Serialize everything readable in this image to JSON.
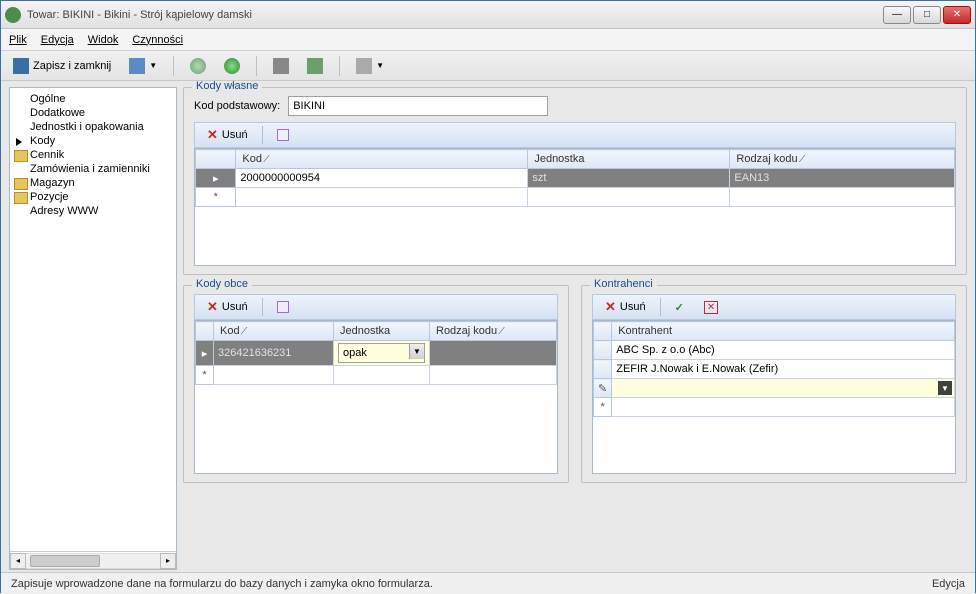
{
  "window": {
    "title": "Towar: BIKINI - Bikini - Strój kąpielowy damski"
  },
  "menu": {
    "file": "Plik",
    "edit": "Edycja",
    "view": "Widok",
    "actions": "Czynności"
  },
  "toolbar": {
    "save_close": "Zapisz i zamknij"
  },
  "sidebar": {
    "items": [
      {
        "label": "Ogólne"
      },
      {
        "label": "Dodatkowe"
      },
      {
        "label": "Jednostki i opakowania"
      },
      {
        "label": "Kody"
      },
      {
        "label": "Cennik"
      },
      {
        "label": "Zamówienia i zamienniki"
      },
      {
        "label": "Magazyn"
      },
      {
        "label": "Pozycje"
      },
      {
        "label": "Adresy WWW"
      }
    ]
  },
  "codes_own": {
    "legend": "Kody własne",
    "base_label": "Kod podstawowy:",
    "base_value": "BIKINI",
    "delete": "Usuń",
    "headers": {
      "code": "Kod",
      "unit": "Jednostka",
      "type": "Rodzaj kodu"
    },
    "rows": [
      {
        "code": "2000000000954",
        "unit": "szt",
        "type": "EAN13"
      }
    ]
  },
  "codes_foreign": {
    "legend": "Kody obce",
    "delete": "Usuń",
    "headers": {
      "code": "Kod",
      "unit": "Jednostka",
      "type": "Rodzaj kodu"
    },
    "rows": [
      {
        "code": "326421636231",
        "unit": "opak",
        "type": ""
      }
    ]
  },
  "contractors": {
    "legend": "Kontrahenci",
    "delete": "Usuń",
    "header": "Kontrahent",
    "rows": [
      "ABC Sp. z o.o (Abc)",
      "ZEFIR J.Nowak i E.Nowak (Zefir)"
    ]
  },
  "status": {
    "left": "Zapisuje wprowadzone dane na formularzu do bazy danych i zamyka okno formularza.",
    "right": "Edycja"
  }
}
